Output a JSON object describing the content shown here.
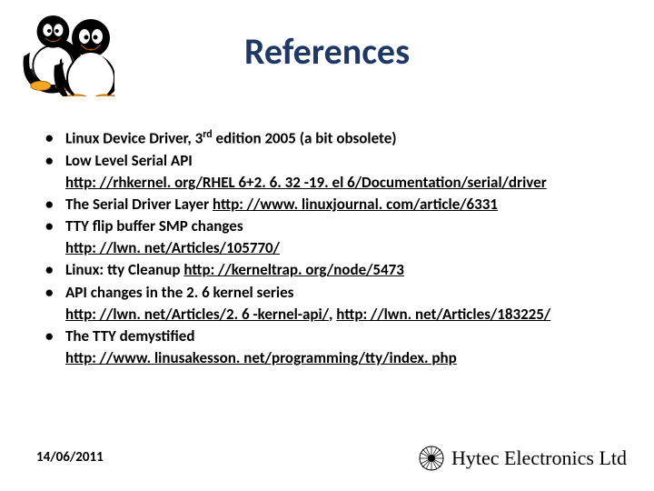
{
  "title": "References",
  "items": [
    {
      "pre": "Linux Device Driver, 3",
      "sup": "rd",
      "post": " edition 2005 (a bit obsolete)"
    },
    {
      "text": "Low Level Serial API"
    },
    {
      "indent": true,
      "link": "http: //rhkernel. org/RHEL 6+2. 6. 32 -19. el 6/Documentation/serial/driver"
    },
    {
      "text": "The Serial Driver Layer ",
      "link": "http: //www. linuxjournal. com/article/6331"
    },
    {
      "text": "TTY flip buffer SMP changes"
    },
    {
      "indent": true,
      "link": "http: //lwn. net/Articles/105770/"
    },
    {
      "text": "Linux: tty Cleanup ",
      "link": "http: //kerneltrap. org/node/5473"
    },
    {
      "text": "API changes in the 2. 6 kernel series"
    },
    {
      "indent": true,
      "link": "http: //lwn. net/Articles/2. 6 -kernel-api/",
      "mid": ",  ",
      "link2": "http: //lwn. net/Articles/183225/"
    },
    {
      "text": "The TTY demystified"
    },
    {
      "indent": true,
      "link": "http: //www. linusakesson. net/programming/tty/index. php"
    }
  ],
  "footer": {
    "date": "14/06/2011",
    "company": "Hytec Electronics Ltd"
  }
}
